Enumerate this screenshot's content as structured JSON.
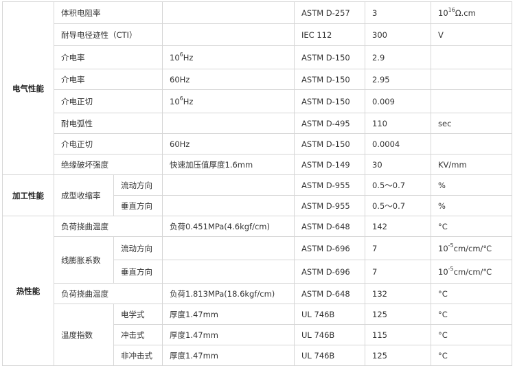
{
  "categories": {
    "electrical": "电气性能",
    "processing": "加工性能",
    "thermal": "热性能"
  },
  "rows": {
    "r1": {
      "prop": "体积电阻率",
      "cond": "",
      "method": "ASTM D-257",
      "value": "3",
      "unit_base": "10",
      "unit_exp": "16",
      "unit_rest": "Ω.cm"
    },
    "r2": {
      "prop": "耐导电径迹性（CTI）",
      "cond": "",
      "method": "IEC 112",
      "value": "300",
      "unit": "V"
    },
    "r3": {
      "prop": "介电率",
      "cond_base": "10",
      "cond_exp": "6",
      "cond_rest": "Hz",
      "method": "ASTM D-150",
      "value": "2.9",
      "unit": ""
    },
    "r4": {
      "prop": "介电率",
      "cond": "60Hz",
      "method": "ASTM D-150",
      "value": "2.95",
      "unit": ""
    },
    "r5": {
      "prop": "介电正切",
      "cond_base": "10",
      "cond_exp": "6",
      "cond_rest": "Hz",
      "method": "ASTM D-150",
      "value": "0.009",
      "unit": ""
    },
    "r6": {
      "prop": "耐电弧性",
      "cond": "",
      "method": "ASTM D-495",
      "value": "110",
      "unit": "sec"
    },
    "r7": {
      "prop": "介电正切",
      "cond": "60Hz",
      "method": "ASTM D-150",
      "value": "0.0004",
      "unit": ""
    },
    "r8": {
      "prop": "绝缘破坏强度",
      "cond": "快速加压值厚度1.6mm",
      "method": "ASTM D-149",
      "value": "30",
      "unit": "KV/mm"
    },
    "r9": {
      "prop": "成型收缩率",
      "sub": "流动方向",
      "cond": "",
      "method": "ASTM D-955",
      "value": "0.5～0.7",
      "unit": "%"
    },
    "r10": {
      "sub": "垂直方向",
      "cond": "",
      "method": "ASTM D-955",
      "value": "0.5～0.7",
      "unit": "%"
    },
    "r11": {
      "prop": "负荷挠曲温度",
      "cond": "负荷0.451MPa(4.6kgf/cm)",
      "method": "ASTM D-648",
      "value": "142",
      "unit": "°C"
    },
    "r12": {
      "prop": "线膨胀系数",
      "sub": "流动方向",
      "cond": "",
      "method": "ASTM D-696",
      "value": "7",
      "unit_base": "10",
      "unit_exp": "-5",
      "unit_rest": "cm/cm/℃"
    },
    "r13": {
      "sub": "垂直方向",
      "cond": "",
      "method": "ASTM D-696",
      "value": "7",
      "unit_base": "10",
      "unit_exp": "-5",
      "unit_rest": "cm/cm/℃"
    },
    "r14": {
      "prop": "负荷挠曲温度",
      "cond": "负荷1.813MPa(18.6kgf/cm)",
      "method": "ASTM D-648",
      "value": "132",
      "unit": "°C"
    },
    "r15": {
      "prop": "温度指数",
      "sub": "电学式",
      "cond": "厚度1.47mm",
      "method": "UL 746B",
      "value": "125",
      "unit": "°C"
    },
    "r16": {
      "sub": "冲击式",
      "cond": "厚度1.47mm",
      "method": "UL 746B",
      "value": "115",
      "unit": "°C"
    },
    "r17": {
      "sub": "非冲击式",
      "cond": "厚度1.47mm",
      "method": "UL 746B",
      "value": "125",
      "unit": "°C"
    }
  }
}
